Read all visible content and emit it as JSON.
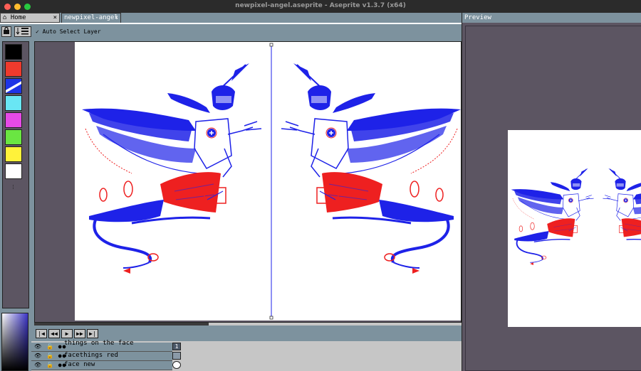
{
  "window": {
    "title": "newpixel-angel.aseprite - Aseprite v1.3.7 (x64)"
  },
  "tabs": {
    "home_label": "Home",
    "home_icon": "home-icon",
    "file_label": "newpixel-angel",
    "close_glyph": "×"
  },
  "context_bar": {
    "auto_select_label": "Auto Select Layer"
  },
  "palette": {
    "colors": [
      "#000000",
      "#ee3a2d",
      "#1e35e6",
      "#69e6f4",
      "#e64ae6",
      "#6ae642",
      "#fff23a",
      "#ffffff"
    ]
  },
  "preview": {
    "title": "Preview"
  },
  "layers": [
    {
      "name": "things on the face"
    },
    {
      "name": "facethings red"
    },
    {
      "name": "face new"
    }
  ],
  "colors": {
    "ink_blue": "#1e22e8",
    "ink_red": "#ee2020",
    "panel": "#7d929e",
    "workspace": "#5c5562"
  },
  "timeline": {
    "frame_number": "1"
  }
}
